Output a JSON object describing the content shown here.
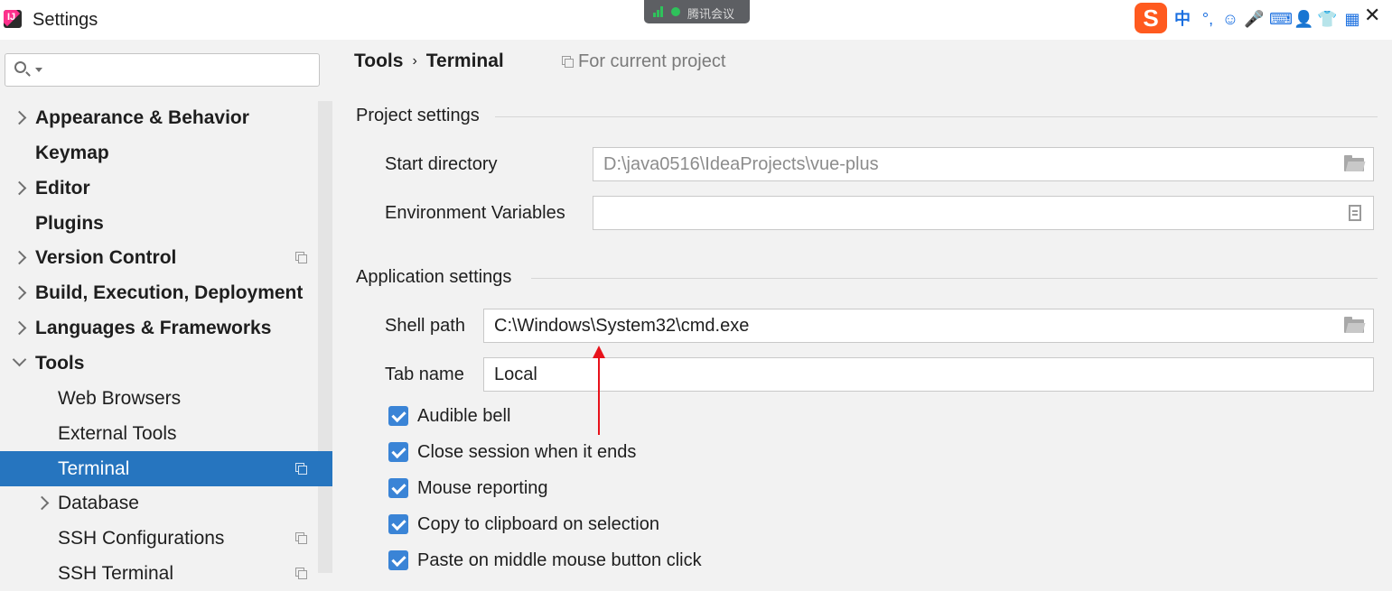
{
  "window": {
    "title": "Settings"
  },
  "meeting_badge": {
    "label": "腾讯会议"
  },
  "ime": {
    "logo": "S",
    "items": [
      "中",
      "°,",
      "☺",
      "🎤",
      "⌨",
      "👤",
      "👕",
      "▦"
    ]
  },
  "sidebar": {
    "search_placeholder": "",
    "items": [
      {
        "label": "Appearance & Behavior",
        "bold": true,
        "expander": "collapsed",
        "level": 0
      },
      {
        "label": "Keymap",
        "bold": true,
        "expander": "none",
        "level": 0
      },
      {
        "label": "Editor",
        "bold": true,
        "expander": "collapsed",
        "level": 0
      },
      {
        "label": "Plugins",
        "bold": true,
        "expander": "none",
        "level": 0
      },
      {
        "label": "Version Control",
        "bold": true,
        "expander": "collapsed",
        "level": 0,
        "project_icon": true
      },
      {
        "label": "Build, Execution, Deployment",
        "bold": true,
        "expander": "collapsed",
        "level": 0
      },
      {
        "label": "Languages & Frameworks",
        "bold": true,
        "expander": "collapsed",
        "level": 0
      },
      {
        "label": "Tools",
        "bold": true,
        "expander": "expanded",
        "level": 0
      },
      {
        "label": "Web Browsers",
        "bold": false,
        "expander": "none",
        "level": 1
      },
      {
        "label": "External Tools",
        "bold": false,
        "expander": "none",
        "level": 1
      },
      {
        "label": "Terminal",
        "bold": false,
        "expander": "none",
        "level": 1,
        "project_icon": true,
        "selected": true
      },
      {
        "label": "Database",
        "bold": false,
        "expander": "collapsed",
        "level": 1
      },
      {
        "label": "SSH Configurations",
        "bold": false,
        "expander": "none",
        "level": 1,
        "project_icon": true
      },
      {
        "label": "SSH Terminal",
        "bold": false,
        "expander": "none",
        "level": 1,
        "project_icon": true
      }
    ]
  },
  "breadcrumb": {
    "parent": "Tools",
    "separator": "›",
    "current": "Terminal"
  },
  "for_current_project": "For current project",
  "project_settings": {
    "title": "Project settings",
    "start_directory": {
      "label": "Start directory",
      "value": "D:\\java0516\\IdeaProjects\\vue-plus"
    },
    "environment_variables": {
      "label": "Environment Variables",
      "value": ""
    }
  },
  "application_settings": {
    "title": "Application settings",
    "shell_path": {
      "label": "Shell path",
      "value": "C:\\Windows\\System32\\cmd.exe"
    },
    "tab_name": {
      "label": "Tab name",
      "value": "Local"
    },
    "checkboxes": [
      {
        "label": "Audible bell",
        "checked": true
      },
      {
        "label": "Close session when it ends",
        "checked": true
      },
      {
        "label": "Mouse reporting",
        "checked": true
      },
      {
        "label": "Copy to clipboard on selection",
        "checked": true
      },
      {
        "label": "Paste on middle mouse button click",
        "checked": true
      }
    ]
  },
  "colors": {
    "selection": "#2675bf",
    "checkbox": "#3a84d6",
    "annotation_arrow": "#e8121b"
  }
}
